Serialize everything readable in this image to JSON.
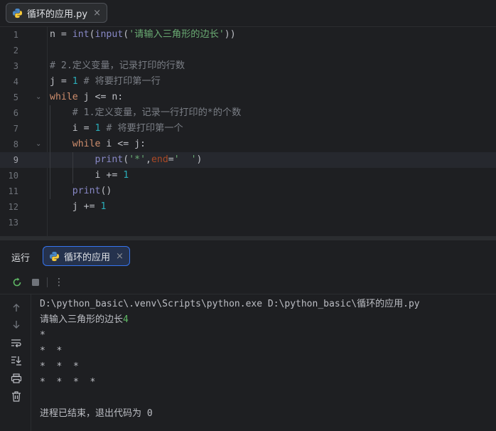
{
  "editor_tab": {
    "filename": "循环的应用.py",
    "close": "×"
  },
  "editor": {
    "line_numbers": [
      "1",
      "2",
      "3",
      "4",
      "5",
      "6",
      "7",
      "8",
      "9",
      "10",
      "11",
      "12",
      "13"
    ],
    "current_line": 9,
    "lines": [
      [
        {
          "t": "n = ",
          "c": ""
        },
        {
          "t": "int",
          "c": "bi"
        },
        {
          "t": "(",
          "c": ""
        },
        {
          "t": "input",
          "c": "bi"
        },
        {
          "t": "(",
          "c": ""
        },
        {
          "t": "'请输入三角形的边长'",
          "c": "st"
        },
        {
          "t": "))",
          "c": ""
        }
      ],
      [],
      [
        {
          "t": "# 2.定义变量，记录打印的行数",
          "c": "cm"
        }
      ],
      [
        {
          "t": "j = ",
          "c": ""
        },
        {
          "t": "1",
          "c": "nm"
        },
        {
          "t": " ",
          "c": ""
        },
        {
          "t": "# 将要打印第一行",
          "c": "cm"
        }
      ],
      [
        {
          "t": "while",
          "c": "kw"
        },
        {
          "t": " j <= n:",
          "c": ""
        }
      ],
      [
        {
          "t": "    ",
          "c": ""
        },
        {
          "t": "# 1.定义变量，记录一行打印的*的个数",
          "c": "cm"
        }
      ],
      [
        {
          "t": "    i = ",
          "c": ""
        },
        {
          "t": "1",
          "c": "nm"
        },
        {
          "t": " ",
          "c": ""
        },
        {
          "t": "# 将要打印第一个",
          "c": "cm"
        }
      ],
      [
        {
          "t": "    ",
          "c": ""
        },
        {
          "t": "while",
          "c": "kw"
        },
        {
          "t": " i <= j:",
          "c": ""
        }
      ],
      [
        {
          "t": "        ",
          "c": ""
        },
        {
          "t": "print",
          "c": "bi"
        },
        {
          "t": "(",
          "c": ""
        },
        {
          "t": "'*'",
          "c": "st"
        },
        {
          "t": ",",
          "c": ""
        },
        {
          "t": "end",
          "c": "pa"
        },
        {
          "t": "=",
          "c": ""
        },
        {
          "t": "'  '",
          "c": "st"
        },
        {
          "t": ")",
          "c": ""
        }
      ],
      [
        {
          "t": "        i += ",
          "c": ""
        },
        {
          "t": "1",
          "c": "nm"
        }
      ],
      [
        {
          "t": "    ",
          "c": ""
        },
        {
          "t": "print",
          "c": "bi"
        },
        {
          "t": "()",
          "c": ""
        }
      ],
      [
        {
          "t": "    j += ",
          "c": ""
        },
        {
          "t": "1",
          "c": "nm"
        }
      ],
      []
    ]
  },
  "run_panel": {
    "title": "运行",
    "tab_label": "循环的应用",
    "close": "×",
    "toolbar": {
      "rerun_icon": "rerun-icon",
      "stop_icon": "stop-icon",
      "more": "⋮"
    },
    "sidebar_icons": [
      "up-arrow-icon",
      "down-arrow-icon",
      "soft-wrap-icon",
      "scroll-to-end-icon",
      "print-icon",
      "trash-icon"
    ],
    "console": {
      "command": "D:\\python_basic\\.venv\\Scripts\\python.exe D:\\python_basic\\循环的应用.py",
      "prompt": "请输入三角形的边长",
      "user_input": "4",
      "output": [
        "*",
        "*  *",
        "*  *  *",
        "*  *  *  *",
        ""
      ],
      "exit_message": "进程已结束，退出代码为 0"
    }
  },
  "colors": {
    "keyword": "#cf8e6d",
    "builtin": "#8888c6",
    "string": "#6aab73",
    "number": "#2aacb8",
    "comment": "#7a7e85",
    "accent": "#3574f0"
  }
}
